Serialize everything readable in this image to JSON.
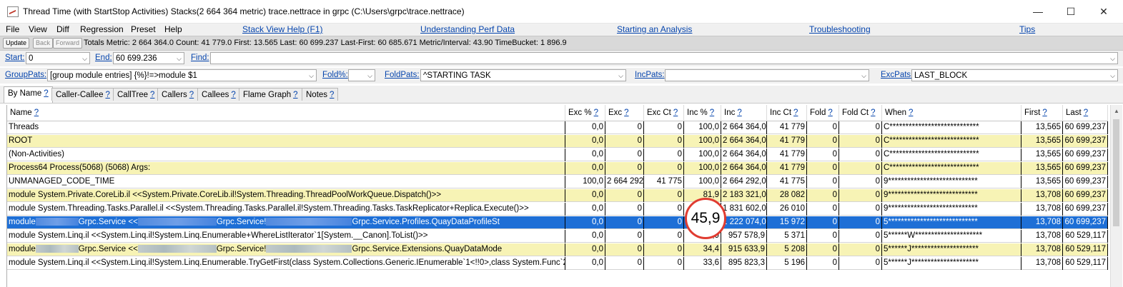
{
  "window": {
    "title": "Thread Time (with StartStop Activities) Stacks(2 664 364 metric) trace.nettrace in grpc (C:\\Users\\grpc\\trace.nettrace)",
    "min": "—",
    "max": "☐",
    "close": "✕"
  },
  "menu": {
    "items": [
      "File",
      "View",
      "Diff",
      "Regression",
      "Preset",
      "Help"
    ],
    "links": [
      "Stack View Help (F1)",
      "Understanding Perf Data",
      "Starting an Analysis",
      "Troubleshooting",
      "Tips"
    ]
  },
  "status": {
    "update": "Update",
    "back": "Back",
    "forward": "Forward",
    "totals": "Totals Metric: 2 664 364.0  Count: 41 779.0  First: 13.565  Last: 60 699.237  Last-First: 60 685.671  Metric/Interval: 43.90  TimeBucket: 1 896.9"
  },
  "filters": {
    "start_label": "Start:",
    "start_value": "0",
    "end_label": "End:",
    "end_value": "60 699.236",
    "find_label": "Find:",
    "find_value": "",
    "grouppats_label": "GroupPats:",
    "grouppats_value": "[group module entries]  {%}!=>module $1",
    "foldpct_label": "Fold%:",
    "foldpct_value": "",
    "foldpats_label": "FoldPats:",
    "foldpats_value": "^STARTING TASK",
    "incpats_label": "IncPats:",
    "incpats_value": "",
    "excpats_label": "ExcPats:",
    "excpats_value": "LAST_BLOCK"
  },
  "tabs": [
    "By Name",
    "Caller-Callee",
    "CallTree",
    "Callers",
    "Callees",
    "Flame Graph",
    "Notes"
  ],
  "help_mark": "?",
  "columns": [
    "Name",
    "Exc %",
    "Exc",
    "Exc Ct",
    "Inc %",
    "Inc",
    "Inc Ct",
    "Fold",
    "Fold Ct",
    "When",
    "First",
    "Last"
  ],
  "rows": [
    {
      "name": "Threads",
      "exc_pct": "0,0",
      "exc": "0",
      "exc_ct": "0",
      "inc_pct": "100,0",
      "inc": "2 664 364,0",
      "inc_ct": "41 779",
      "fold": "0",
      "fold_ct": "0",
      "when": "C****************************",
      "first": "13,565",
      "last": "60 699,237",
      "style": "white"
    },
    {
      "name": "ROOT",
      "exc_pct": "0,0",
      "exc": "0",
      "exc_ct": "0",
      "inc_pct": "100,0",
      "inc": "2 664 364,0",
      "inc_ct": "41 779",
      "fold": "0",
      "fold_ct": "0",
      "when": "C****************************",
      "first": "13,565",
      "last": "60 699,237",
      "style": "yellow"
    },
    {
      "name": "(Non-Activities)",
      "exc_pct": "0,0",
      "exc": "0",
      "exc_ct": "0",
      "inc_pct": "100,0",
      "inc": "2 664 364,0",
      "inc_ct": "41 779",
      "fold": "0",
      "fold_ct": "0",
      "when": "C****************************",
      "first": "13,565",
      "last": "60 699,237",
      "style": "white"
    },
    {
      "name": "Process64 Process(5068) (5068) Args:",
      "exc_pct": "0,0",
      "exc": "0",
      "exc_ct": "0",
      "inc_pct": "100,0",
      "inc": "2 664 364,0",
      "inc_ct": "41 779",
      "fold": "0",
      "fold_ct": "0",
      "when": "C****************************",
      "first": "13,565",
      "last": "60 699,237",
      "style": "yellow"
    },
    {
      "name": "UNMANAGED_CODE_TIME",
      "exc_pct": "100,0",
      "exc": "2 664 292",
      "exc_ct": "41 775",
      "inc_pct": "100,0",
      "inc": "2 664 292,0",
      "inc_ct": "41 775",
      "fold": "0",
      "fold_ct": "0",
      "when": "9****************************",
      "first": "13,565",
      "last": "60 699,237",
      "style": "white"
    },
    {
      "name": "module System.Private.CoreLib.il <<System.Private.CoreLib.il!System.Threading.ThreadPoolWorkQueue.Dispatch()>>",
      "exc_pct": "0,0",
      "exc": "0",
      "exc_ct": "0",
      "inc_pct": "81,9",
      "inc": "2 183 321,0",
      "inc_ct": "28 082",
      "fold": "0",
      "fold_ct": "0",
      "when": "9****************************",
      "first": "13,708",
      "last": "60 699,237",
      "style": "yellow"
    },
    {
      "name": "module System.Threading.Tasks.Parallel.il <<System.Threading.Tasks.Parallel.il!System.Threading.Tasks.TaskReplicator+Replica.Execute()>>",
      "exc_pct": "0,0",
      "exc": "0",
      "exc_ct": "0",
      "inc_pct": "68,7",
      "inc": "1 831 602,0",
      "inc_ct": "26 010",
      "fold": "0",
      "fold_ct": "0",
      "when": "9****************************",
      "first": "13,708",
      "last": "60 699,237",
      "style": "white"
    },
    {
      "name_a": "module",
      "name_b": "Grpc.Service <<",
      "name_c": "Grpc.Service!",
      "name_d": "Grpc.Service.Profiles.QuayDataProfileSt",
      "exc_pct": "0,0",
      "exc": "0",
      "exc_ct": "0",
      "inc_pct": "45,9",
      "inc": "1 222 074,0",
      "inc_ct": "15 972",
      "fold": "0",
      "fold_ct": "0",
      "when": "5****************************",
      "first": "13,708",
      "last": "60 699,237",
      "style": "selected"
    },
    {
      "name": "module System.Linq.il <<System.Linq.il!System.Linq.Enumerable+WhereListIterator`1[System.__Canon].ToList()>>",
      "exc_pct": "0,0",
      "exc": "0",
      "exc_ct": "0",
      "inc_pct": "35,9",
      "inc": "957 578,9",
      "inc_ct": "5 371",
      "fold": "0",
      "fold_ct": "0",
      "when": "5******W*********************",
      "first": "13,708",
      "last": "60 529,117",
      "style": "white"
    },
    {
      "name_a": "module",
      "name_b": "Grpc.Service <<",
      "name_c": "Grpc.Service!",
      "name_d": "Grpc.Service.Extensions.QuayDataMode",
      "exc_pct": "0,0",
      "exc": "0",
      "exc_ct": "0",
      "inc_pct": "34,4",
      "inc": "915 633,9",
      "inc_ct": "5 208",
      "fold": "0",
      "fold_ct": "0",
      "when": "5******J*********************",
      "first": "13,708",
      "last": "60 529,117",
      "style": "yellow"
    },
    {
      "name": "module System.Linq.il <<System.Linq.il!System.Linq.Enumerable.TryGetFirst(class System.Collections.Generic.IEnumerable`1<!!0>,class System.Func`2",
      "exc_pct": "0,0",
      "exc": "0",
      "exc_ct": "0",
      "inc_pct": "33,6",
      "inc": "895 823,3",
      "inc_ct": "5 196",
      "fold": "0",
      "fold_ct": "0",
      "when": "5******J*********************",
      "first": "13,708",
      "last": "60 529,117",
      "style": "white"
    }
  ],
  "zoom_value": "45,9"
}
